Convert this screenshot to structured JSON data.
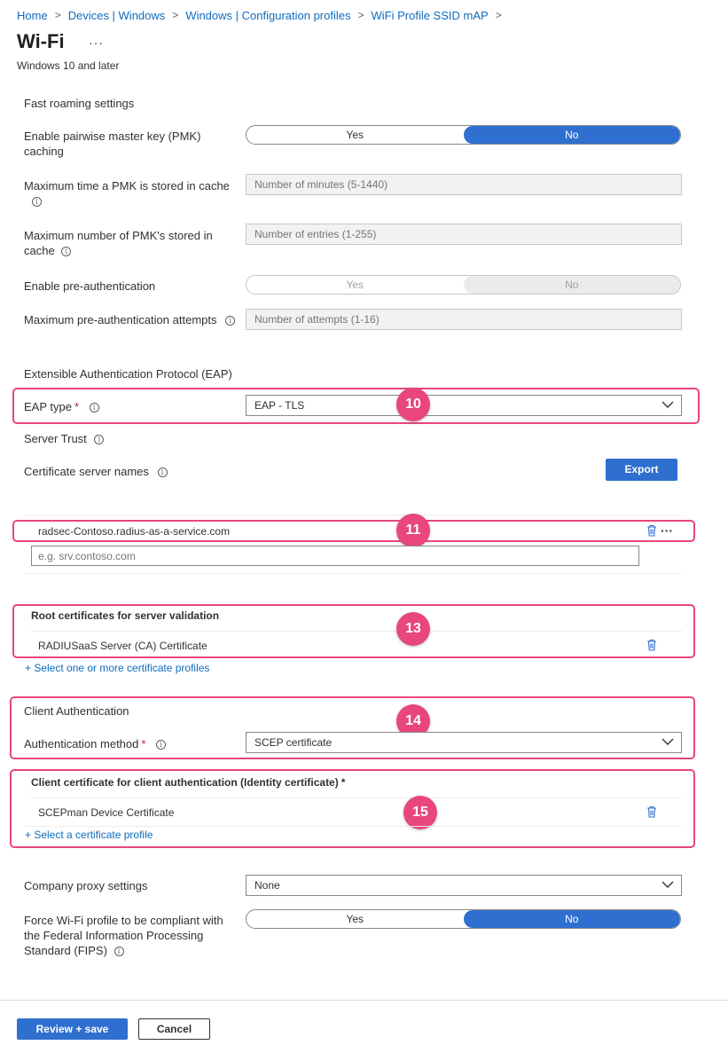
{
  "breadcrumb": [
    "Home",
    "Devices | Windows",
    "Windows | Configuration profiles",
    "WiFi Profile SSID mAP"
  ],
  "page": {
    "title": "Wi-Fi",
    "more": "···",
    "subtitle": "Windows 10 and later"
  },
  "fast_roaming": {
    "title": "Fast roaming settings",
    "pmk_caching": {
      "label": "Enable pairwise master key (PMK) caching",
      "options": [
        "Yes",
        "No"
      ],
      "selected": "No"
    },
    "pmk_max_time": {
      "label": "Maximum time a PMK is stored in cache",
      "placeholder": "Number of minutes (5-1440)"
    },
    "pmk_max_count": {
      "label": "Maximum number of PMK's stored in cache",
      "placeholder": "Number of entries (1-255)"
    },
    "pre_auth": {
      "label": "Enable pre-authentication",
      "options": [
        "Yes",
        "No"
      ],
      "selected": "No"
    },
    "pre_auth_attempts": {
      "label": "Maximum pre-authentication attempts",
      "placeholder": "Number of attempts (1-16)"
    }
  },
  "eap": {
    "title": "Extensible Authentication Protocol (EAP)",
    "type_label": "EAP type",
    "type_value": "EAP - TLS",
    "server_trust": "Server Trust",
    "cert_server_names_label": "Certificate server names",
    "export_label": "Export",
    "server_name_entry": "radsec-Contoso.radius-as-a-service.com",
    "server_name_more": "···",
    "server_name_placeholder": "e.g. srv.contoso.com"
  },
  "root_certs": {
    "title": "Root certificates for server validation",
    "item": "RADIUSaaS Server (CA) Certificate",
    "add_link": "+ Select one or more certificate profiles"
  },
  "client_auth": {
    "title": "Client Authentication",
    "method_label": "Authentication method",
    "method_value": "SCEP certificate"
  },
  "client_cert": {
    "title": "Client certificate for client authentication (Identity certificate)",
    "item": "SCEPman Device Certificate",
    "add_link": "+ Select a certificate profile"
  },
  "proxy": {
    "label": "Company proxy settings",
    "value": "None"
  },
  "fips": {
    "label": "Force Wi-Fi profile to be compliant with the Federal Information Processing Standard (FIPS)",
    "options": [
      "Yes",
      "No"
    ],
    "selected": "No"
  },
  "footer": {
    "review_save": "Review + save",
    "cancel": "Cancel"
  },
  "required_marker": "*",
  "info_glyph": "i",
  "callouts": [
    "10",
    "11",
    "13",
    "14",
    "15"
  ],
  "colors": {
    "accent": "#2f6fd0",
    "link": "#0f6cbd",
    "highlight": "#e8467c",
    "required": "#a4262c"
  }
}
